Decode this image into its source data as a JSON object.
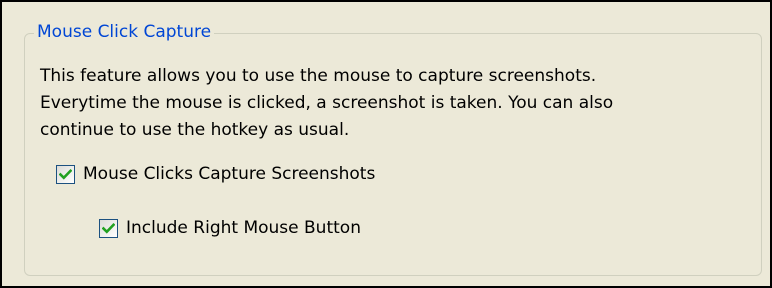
{
  "group": {
    "title": "Mouse Click Capture",
    "description_lines": [
      "This feature allows you to use the mouse to capture screenshots.",
      "Everytime the mouse is clicked, a screenshot is taken. You can also",
      "continue to use the hotkey as usual."
    ]
  },
  "options": [
    {
      "label": "Mouse Clicks Capture Screenshots",
      "checked": true
    },
    {
      "label": "Include Right Mouse Button",
      "checked": true
    }
  ],
  "colors": {
    "legend_text": "#0046d5",
    "checkmark": "#21a121",
    "checkbox_border": "#1c5180",
    "background": "#ece9d8"
  },
  "icons": {
    "checkmark": "checkmark-icon"
  }
}
